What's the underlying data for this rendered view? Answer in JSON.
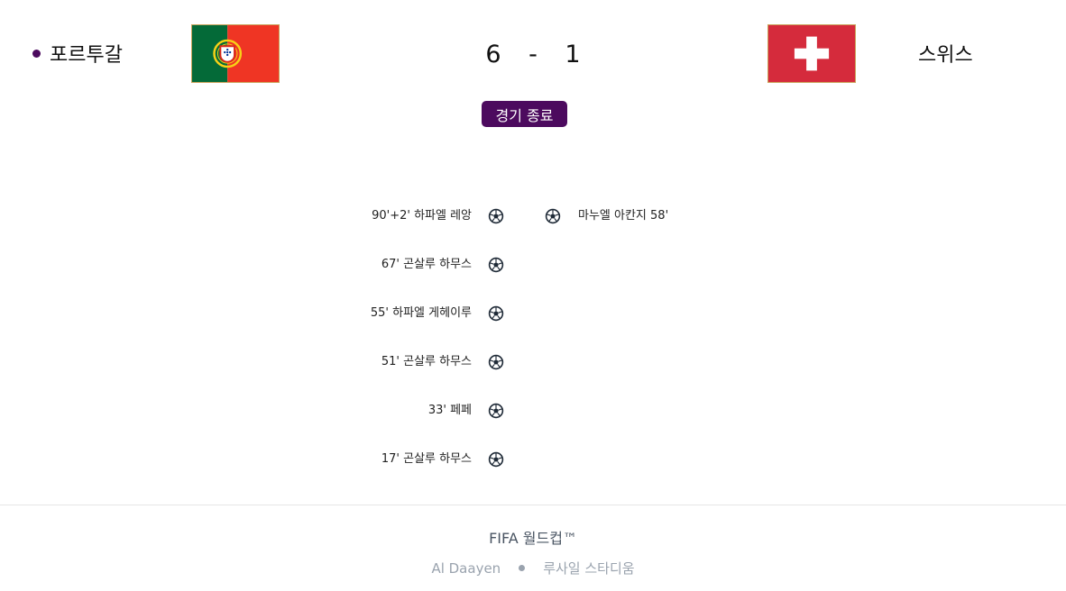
{
  "match": {
    "home_team": "포르투갈",
    "away_team": "스위스",
    "home_score": "6",
    "separator": "-",
    "away_score": "1",
    "status": "경기 종료"
  },
  "icons": {
    "goal": "soccer-ball-icon",
    "home_flag": "portugal-flag-icon",
    "away_flag": "switzerland-flag-icon"
  },
  "colors": {
    "accent": "#4c0a5e",
    "text": "#111111",
    "muted": "#9aa3ae"
  },
  "home_goals": [
    "90'+2' 하파엘 레앙",
    "67' 곤살루 하무스",
    "55' 하파엘 게헤이루",
    "51' 곤살루 하무스",
    "33' 페페",
    "17' 곤살루 하무스"
  ],
  "away_goals": [
    "마누엘 아칸지 58'"
  ],
  "footer": {
    "competition": "FIFA 월드컵™",
    "city": "Al Daayen",
    "stadium": "루사일 스타디움"
  }
}
